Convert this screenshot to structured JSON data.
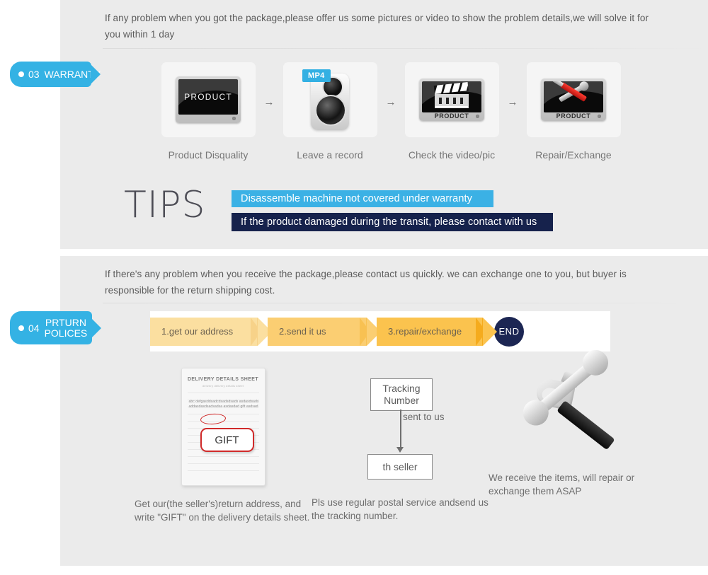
{
  "theme": {
    "panel_bg": "#ebebeb",
    "badge_blue": "#34b2e4",
    "tip_blue": "#3bb1e5",
    "tip_navy": "#16224c",
    "end_navy": "#1c2653",
    "arrow_1": "#fbdfa0",
    "arrow_2": "#fbce72",
    "arrow_3": "#fbc34e",
    "text_gray": "#6e6e6e"
  },
  "warranty_section": {
    "badge": {
      "dot": "bullet-dot",
      "number": "03",
      "label": "WARRANTY"
    },
    "intro": "If any problem when you got the package,please offer us some pictures or video to show the problem details,we will solve it for you within 1 day",
    "steps": [
      {
        "caption": "Product Disquality",
        "icon": "monitor-product-icon",
        "screen_text": "PRODUCT"
      },
      {
        "caption": "Leave a record",
        "icon": "camera-icon",
        "tag": "MP4"
      },
      {
        "caption": "Check the video/pic",
        "icon": "clapperboard-monitor-icon",
        "base_label": "PRODUCT"
      },
      {
        "caption": "Repair/Exchange",
        "icon": "tools-monitor-icon",
        "base_label": "PRODUCT"
      }
    ],
    "arrow_glyph": "→",
    "tips": {
      "heading": "TIPS",
      "lines": [
        "Disassemble machine not covered under warranty",
        "If the product damaged during the transit, please contact with us"
      ]
    }
  },
  "returns_section": {
    "badge": {
      "dot": "bullet-dot",
      "number": "04",
      "label_line1": "PRTURN",
      "label_line2": "POLICES"
    },
    "intro": "If  there's any problem when you receive the package,please contact us quickly. we can exchange one to you, but buyer is responsible for the return shipping cost.",
    "process": {
      "steps": [
        "1.get our address",
        "2.send it us",
        "3.repair/exchange"
      ],
      "end_label": "END"
    },
    "columns": [
      {
        "illustration": "delivery-details-sheet",
        "sheet": {
          "title": "DELIVERY DETAILS SHEET",
          "subtitle": "delivery        delivery details sheet",
          "body_text": "abc defgasddsadcdsadsdsads asdasdsadsaddasdasdsadsadsa asdasdad gift asdsad",
          "callout": "GIFT"
        },
        "caption": "Get our(the seller's)return address, and write \"GIFT\" on the delivery details sheet."
      },
      {
        "illustration": "tracking-number-diagram",
        "diagram": {
          "top_box": "Tracking Number",
          "edge_label": "sent to us",
          "bottom_box": "th seller"
        },
        "caption": "Pls use regular postal service andsend us the tracking number."
      },
      {
        "illustration": "hammer-wrench-icon",
        "caption": "We receive the items, will repair or exchange them ASAP"
      }
    ]
  }
}
